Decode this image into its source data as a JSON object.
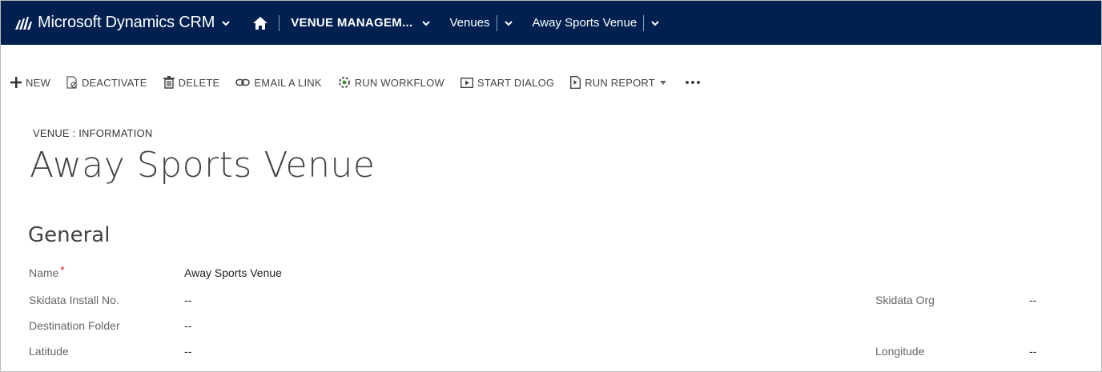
{
  "nav": {
    "app_name": "Microsoft Dynamics CRM",
    "area": "VENUE MANAGEM...",
    "entity": "Venues",
    "record": "Away Sports Venue",
    "bg_color": "#002050"
  },
  "commands": [
    {
      "label": "NEW",
      "icon": "plus-icon"
    },
    {
      "label": "DEACTIVATE",
      "icon": "deactivate-icon"
    },
    {
      "label": "DELETE",
      "icon": "trash-icon"
    },
    {
      "label": "EMAIL A LINK",
      "icon": "link-icon"
    },
    {
      "label": "RUN WORKFLOW",
      "icon": "workflow-icon"
    },
    {
      "label": "START DIALOG",
      "icon": "dialog-icon"
    },
    {
      "label": "RUN REPORT",
      "icon": "report-icon"
    }
  ],
  "header": {
    "entity_label": "VENUE : INFORMATION",
    "title": "Away Sports Venue"
  },
  "section": {
    "title": "General"
  },
  "fields": {
    "name_label": "Name",
    "name_required": "*",
    "name_value": "Away Sports Venue",
    "skidata_install_label": "Skidata Install No.",
    "skidata_install_value": "--",
    "destination_folder_label": "Destination Folder",
    "destination_folder_value": "--",
    "latitude_label": "Latitude",
    "latitude_value": "--",
    "skidata_org_label": "Skidata Org",
    "skidata_org_value": "--",
    "longitude_label": "Longitude",
    "longitude_value": "--"
  }
}
